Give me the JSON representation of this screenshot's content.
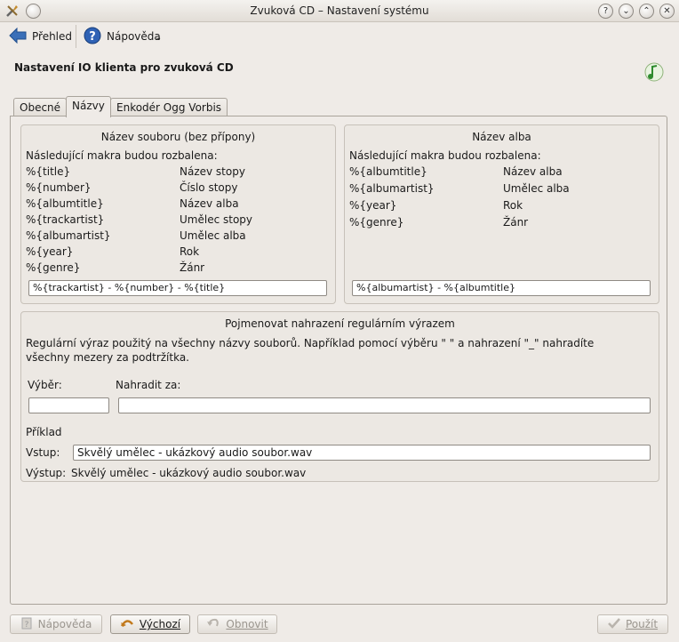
{
  "window": {
    "title": "Zvuková CD – Nastavení systému",
    "buttons": [
      "help-icon",
      "minimize-icon",
      "maximize-icon",
      "close-icon"
    ]
  },
  "toolbar": {
    "overview_label": "Přehled",
    "help_label": "Nápověda"
  },
  "page": {
    "heading": "Nastavení IO klienta pro zvuková CD"
  },
  "tabs": [
    {
      "label": "Obecné",
      "active": false
    },
    {
      "label": "Názvy",
      "active": true
    },
    {
      "label": "Enkodér Ogg Vorbis",
      "active": false
    }
  ],
  "filename_group": {
    "title": "Název souboru (bez přípony)",
    "intro": "Následující makra budou rozbalena:",
    "macros": [
      {
        "macro": "%{title}",
        "desc": "Název stopy"
      },
      {
        "macro": "%{number}",
        "desc": "Číslo stopy"
      },
      {
        "macro": "%{albumtitle}",
        "desc": "Název alba"
      },
      {
        "macro": "%{trackartist}",
        "desc": "Umělec stopy"
      },
      {
        "macro": "%{albumartist}",
        "desc": "Umělec alba"
      },
      {
        "macro": "%{year}",
        "desc": "Rok"
      },
      {
        "macro": "%{genre}",
        "desc": "Žánr"
      }
    ],
    "pattern_value": "%{trackartist} - %{number} - %{title}"
  },
  "album_group": {
    "title": "Název alba",
    "intro": "Následující makra budou rozbalena:",
    "macros": [
      {
        "macro": "%{albumtitle}",
        "desc": "Název alba"
      },
      {
        "macro": "%{albumartist}",
        "desc": "Umělec alba"
      },
      {
        "macro": "%{year}",
        "desc": "Rok"
      },
      {
        "macro": "%{genre}",
        "desc": "Žánr"
      }
    ],
    "pattern_value": "%{albumartist} - %{albumtitle}"
  },
  "regex_group": {
    "title": "Pojmenovat nahrazení regulárním výrazem",
    "description": "Regulární výraz použitý na všechny názvy souborů. Například pomocí výběru \" \" a nahrazení \"_\" nahradíte všechny mezery za podtržítka.",
    "selection_label": "Výběr:",
    "selection_value": "",
    "replace_label": "Nahradit za:",
    "replace_value": "",
    "example_label": "Příklad",
    "input_label": "Vstup:",
    "input_value": "Skvělý umělec - ukázkový audio soubor.wav",
    "output_label": "Výstup:",
    "output_value": "Skvělý umělec - ukázkový audio soubor.wav"
  },
  "footer": {
    "help_label": "Nápověda",
    "defaults_label": "Výchozí",
    "reset_label": "Obnovit",
    "apply_label": "Použít"
  }
}
